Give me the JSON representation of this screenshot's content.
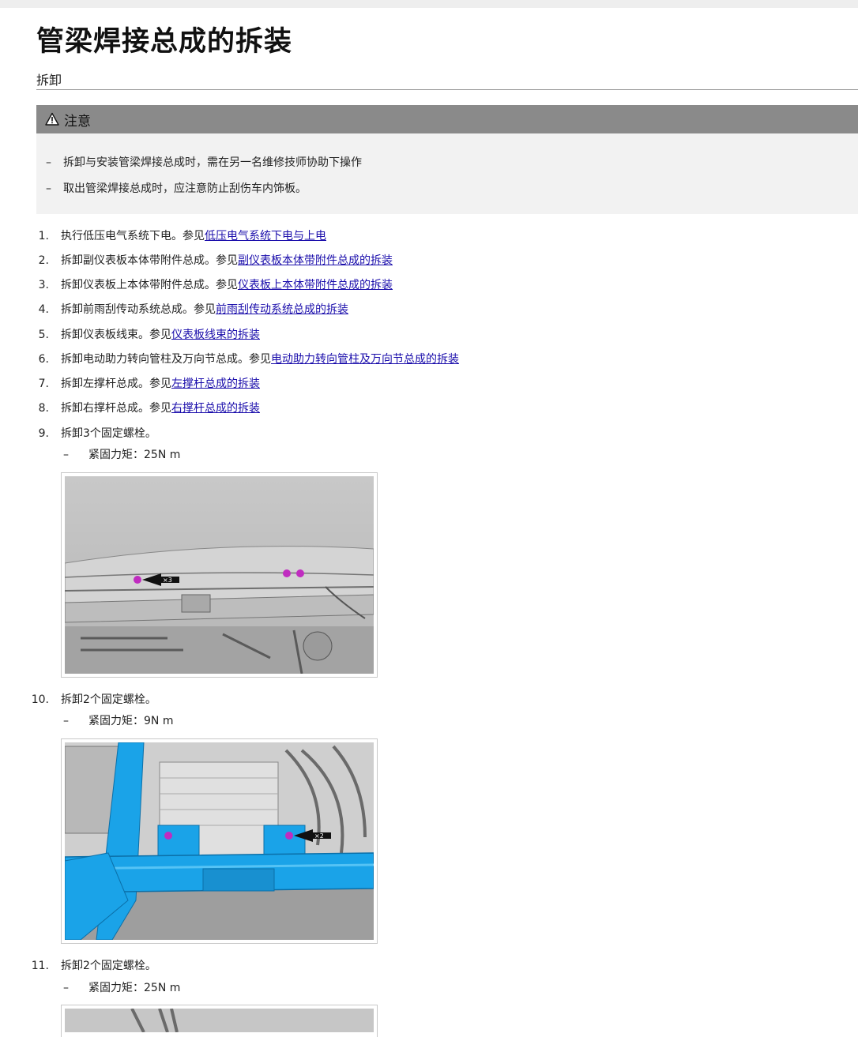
{
  "page": {
    "title": "管梁焊接总成的拆装",
    "section": "拆卸"
  },
  "notice": {
    "heading": "注意",
    "items": [
      "拆卸与安装管梁焊接总成时，需在另一名维修技师协助下操作",
      "取出管梁焊接总成时，应注意防止刮伤车内饰板。"
    ]
  },
  "steps": [
    {
      "num": "1.",
      "text": "执行低压电气系统下电。参见",
      "link": "低压电气系统下电与上电"
    },
    {
      "num": "2.",
      "text": "拆卸副仪表板本体带附件总成。参见",
      "link": "副仪表板本体带附件总成的拆装"
    },
    {
      "num": "3.",
      "text": "拆卸仪表板上本体带附件总成。参见",
      "link": "仪表板上本体带附件总成的拆装"
    },
    {
      "num": "4.",
      "text": "拆卸前雨刮传动系统总成。参见",
      "link": "前雨刮传动系统总成的拆装"
    },
    {
      "num": "5.",
      "text": "拆卸仪表板线束。参见",
      "link": "仪表板线束的拆装"
    },
    {
      "num": "6.",
      "text": "拆卸电动助力转向管柱及万向节总成。参见",
      "link": "电动助力转向管柱及万向节总成的拆装"
    },
    {
      "num": "7.",
      "text": "拆卸左撑杆总成。参见",
      "link": "左撑杆总成的拆装"
    },
    {
      "num": "8.",
      "text": "拆卸右撑杆总成。参见",
      "link": "右撑杆总成的拆装"
    },
    {
      "num": "9.",
      "text": "拆卸3个固定螺栓。",
      "sub": "紧固力矩：25N m",
      "callout": "×3"
    },
    {
      "num": "10.",
      "text": "拆卸2个固定螺栓。",
      "sub": "紧固力矩：9N m",
      "callout": "×2"
    },
    {
      "num": "11.",
      "text": "拆卸2个固定螺栓。",
      "sub": "紧固力矩：25N m"
    }
  ],
  "dash": "–",
  "colors": {
    "link": "#1a0dab",
    "notice_header": "#8a8a8a",
    "notice_body": "#f2f2f2",
    "bolt_marker": "#c02cc0",
    "beam": "#1aa3e8"
  },
  "icons": {
    "warning": "warning-triangle-icon"
  }
}
